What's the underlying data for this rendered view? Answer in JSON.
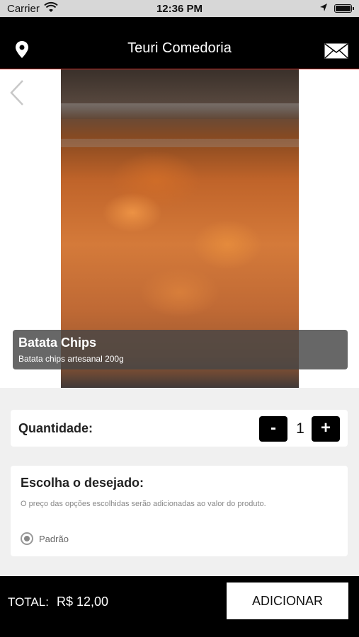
{
  "status_bar": {
    "carrier": "Carrier",
    "time": "12:36 PM"
  },
  "header": {
    "title": "Teuri Comedoria",
    "left_icon": "location-pin-icon",
    "right_icon": "mail-icon"
  },
  "product": {
    "name": "Batata Chips",
    "description": "Batata chips artesanal 200g"
  },
  "quantity": {
    "label": "Quantidade:",
    "minus_label": "-",
    "plus_label": "+",
    "value": "1"
  },
  "options": {
    "title": "Escolha o desejado:",
    "hint": "O preço das opções escolhidas serão adicionadas ao valor do produto.",
    "items": [
      {
        "label": "Padrão",
        "selected": true
      }
    ]
  },
  "footer": {
    "total_label": "TOTAL:",
    "total_value": "R$ 12,00",
    "add_label": "ADICIONAR"
  },
  "colors": {
    "accent_line": "#d8302a",
    "nav_bg": "#000000"
  }
}
